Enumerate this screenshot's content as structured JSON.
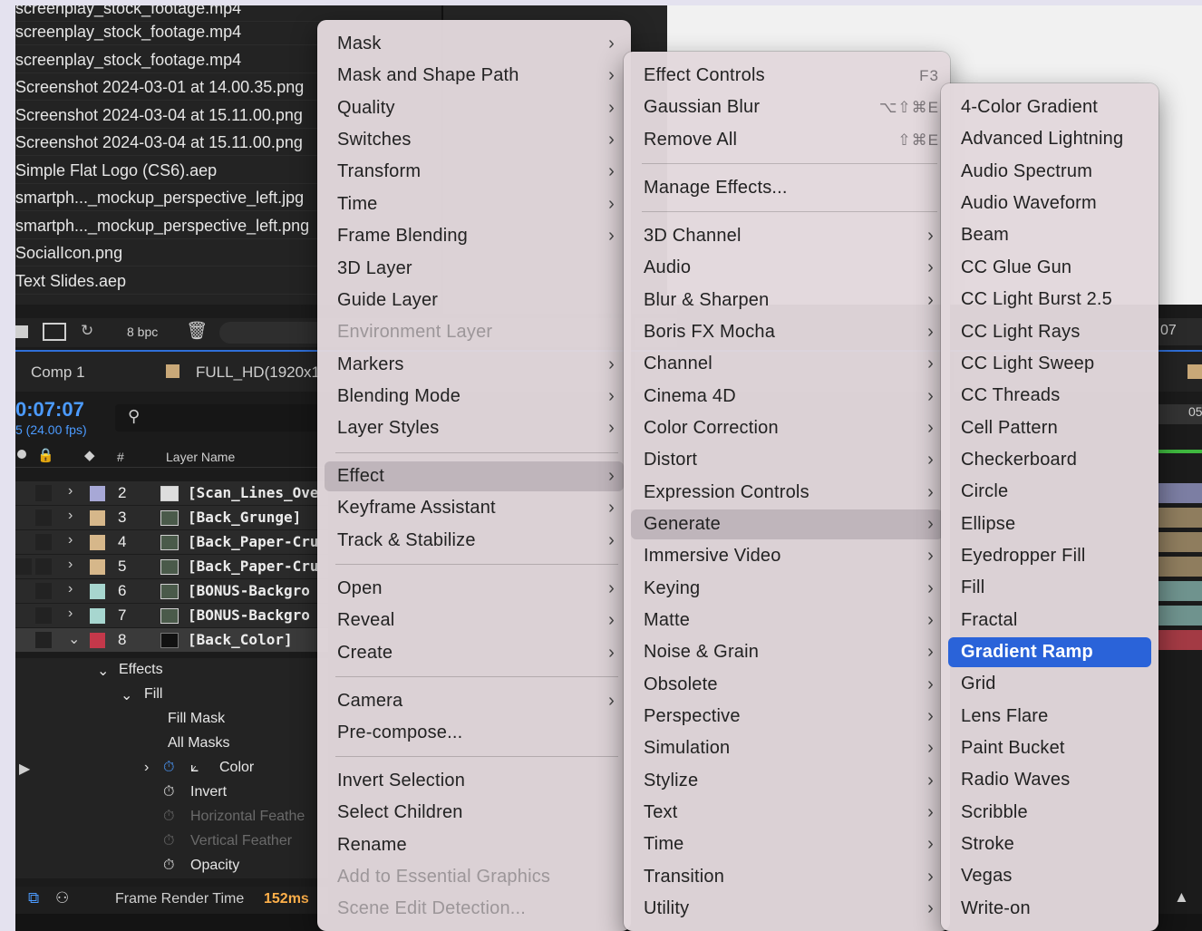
{
  "project_panel": {
    "files": [
      "screenplay_stock_footage.mp4",
      "screenplay_stock_footage.mp4",
      "Screenshot 2024-03-01 at 14.00.35.png",
      "Screenshot 2024-03-04 at 15.11.00.png",
      "Screenshot 2024-03-04 at 15.11.00.png",
      "Simple Flat Logo (CS6).aep",
      "smartph..._mockup_perspective_left.jpg",
      "smartph..._mockup_perspective_left.png",
      "SocialIcon.png",
      "Text Slides.aep"
    ],
    "bpc_label": "8 bpc",
    "right_timecode": "07"
  },
  "comp": {
    "tab_label": "Comp 1",
    "size_label": "FULL_HD(1920x1",
    "timecode": "0:07:07",
    "fps": "5 (24.00 fps)",
    "column_hash": "#",
    "column_layer_name": "Layer Name"
  },
  "layers": [
    {
      "num": "2",
      "name": "[Scan_Lines_Ove",
      "color": "#a7a8d6"
    },
    {
      "num": "3",
      "name": "[Back_Grunge]",
      "color": "#d6b78a"
    },
    {
      "num": "4",
      "name": "[Back_Paper-Cru",
      "color": "#d6b78a"
    },
    {
      "num": "5",
      "name": "[Back_Paper-Cru",
      "color": "#d6b78a"
    },
    {
      "num": "6",
      "name": "[BONUS-Backgro",
      "color": "#a7d6cf"
    },
    {
      "num": "7",
      "name": "[BONUS-Backgro",
      "color": "#a7d6cf"
    },
    {
      "num": "8",
      "name": "[Back_Color]",
      "color": "#c4384a"
    }
  ],
  "effects_tree": {
    "effects": "Effects",
    "fill": "Fill",
    "fill_mask": "Fill Mask",
    "all_masks": "All Masks",
    "color": "Color",
    "invert": "Invert",
    "h_feather": "Horizontal Feathe",
    "v_feather": "Vertical Feather",
    "opacity": "Opacity"
  },
  "status": {
    "render_label": "Frame Render Time",
    "render_value": "152ms"
  },
  "menu_layer": {
    "items": [
      {
        "label": "Mask",
        "submenu": true
      },
      {
        "label": "Mask and Shape Path",
        "submenu": true
      },
      {
        "label": "Quality",
        "submenu": true
      },
      {
        "label": "Switches",
        "submenu": true
      },
      {
        "label": "Transform",
        "submenu": true
      },
      {
        "label": "Time",
        "submenu": true
      },
      {
        "label": "Frame Blending",
        "submenu": true
      },
      {
        "label": "3D Layer",
        "submenu": false
      },
      {
        "label": "Guide Layer",
        "submenu": false
      },
      {
        "label": "Environment Layer",
        "submenu": false,
        "disabled": true
      },
      {
        "label": "Markers",
        "submenu": true
      },
      {
        "label": "Blending Mode",
        "submenu": true
      },
      {
        "label": "Layer Styles",
        "submenu": true
      },
      {
        "label": "Effect",
        "submenu": true,
        "highlight": true
      },
      {
        "label": "Keyframe Assistant",
        "submenu": true
      },
      {
        "label": "Track & Stabilize",
        "submenu": true
      },
      {
        "label": "Open",
        "submenu": true
      },
      {
        "label": "Reveal",
        "submenu": true
      },
      {
        "label": "Create",
        "submenu": true
      },
      {
        "label": "Camera",
        "submenu": true
      },
      {
        "label": "Pre-compose...",
        "submenu": false
      },
      {
        "label": "Invert Selection",
        "submenu": false
      },
      {
        "label": "Select Children",
        "submenu": false
      },
      {
        "label": "Rename",
        "submenu": false
      },
      {
        "label": "Add to Essential Graphics",
        "submenu": false,
        "disabled": true
      },
      {
        "label": "Scene Edit Detection...",
        "submenu": false,
        "disabled": true
      }
    ]
  },
  "menu_effect": {
    "items": [
      {
        "label": "Effect Controls",
        "shortcut": "F3"
      },
      {
        "label": "Gaussian Blur",
        "shortcut": "⌥⇧⌘E"
      },
      {
        "label": "Remove All",
        "shortcut": "⇧⌘E"
      },
      {
        "label": "Manage Effects..."
      },
      {
        "label": "3D Channel",
        "submenu": true
      },
      {
        "label": "Audio",
        "submenu": true
      },
      {
        "label": "Blur & Sharpen",
        "submenu": true
      },
      {
        "label": "Boris FX Mocha",
        "submenu": true
      },
      {
        "label": "Channel",
        "submenu": true
      },
      {
        "label": "Cinema 4D",
        "submenu": true
      },
      {
        "label": "Color Correction",
        "submenu": true
      },
      {
        "label": "Distort",
        "submenu": true
      },
      {
        "label": "Expression Controls",
        "submenu": true
      },
      {
        "label": "Generate",
        "submenu": true,
        "highlight": true
      },
      {
        "label": "Immersive Video",
        "submenu": true
      },
      {
        "label": "Keying",
        "submenu": true
      },
      {
        "label": "Matte",
        "submenu": true
      },
      {
        "label": "Noise & Grain",
        "submenu": true
      },
      {
        "label": "Obsolete",
        "submenu": true
      },
      {
        "label": "Perspective",
        "submenu": true
      },
      {
        "label": "Simulation",
        "submenu": true
      },
      {
        "label": "Stylize",
        "submenu": true
      },
      {
        "label": "Text",
        "submenu": true
      },
      {
        "label": "Time",
        "submenu": true
      },
      {
        "label": "Transition",
        "submenu": true
      },
      {
        "label": "Utility",
        "submenu": true
      }
    ]
  },
  "menu_generate": {
    "items": [
      {
        "label": "4-Color Gradient"
      },
      {
        "label": "Advanced Lightning"
      },
      {
        "label": "Audio Spectrum"
      },
      {
        "label": "Audio Waveform"
      },
      {
        "label": "Beam"
      },
      {
        "label": "CC Glue Gun"
      },
      {
        "label": "CC Light Burst 2.5"
      },
      {
        "label": "CC Light Rays"
      },
      {
        "label": "CC Light Sweep"
      },
      {
        "label": "CC Threads"
      },
      {
        "label": "Cell Pattern"
      },
      {
        "label": "Checkerboard"
      },
      {
        "label": "Circle"
      },
      {
        "label": "Ellipse"
      },
      {
        "label": "Eyedropper Fill"
      },
      {
        "label": "Fill"
      },
      {
        "label": "Fractal"
      },
      {
        "label": "Gradient Ramp",
        "selected": true
      },
      {
        "label": "Grid"
      },
      {
        "label": "Lens Flare"
      },
      {
        "label": "Paint Bucket"
      },
      {
        "label": "Radio Waves"
      },
      {
        "label": "Scribble"
      },
      {
        "label": "Stroke"
      },
      {
        "label": "Vegas"
      },
      {
        "label": "Write-on"
      }
    ]
  },
  "colors": {
    "accent_selection": "#2a63d9",
    "timecode_blue": "#4c9bff",
    "render_time_orange": "#ffb04a"
  }
}
